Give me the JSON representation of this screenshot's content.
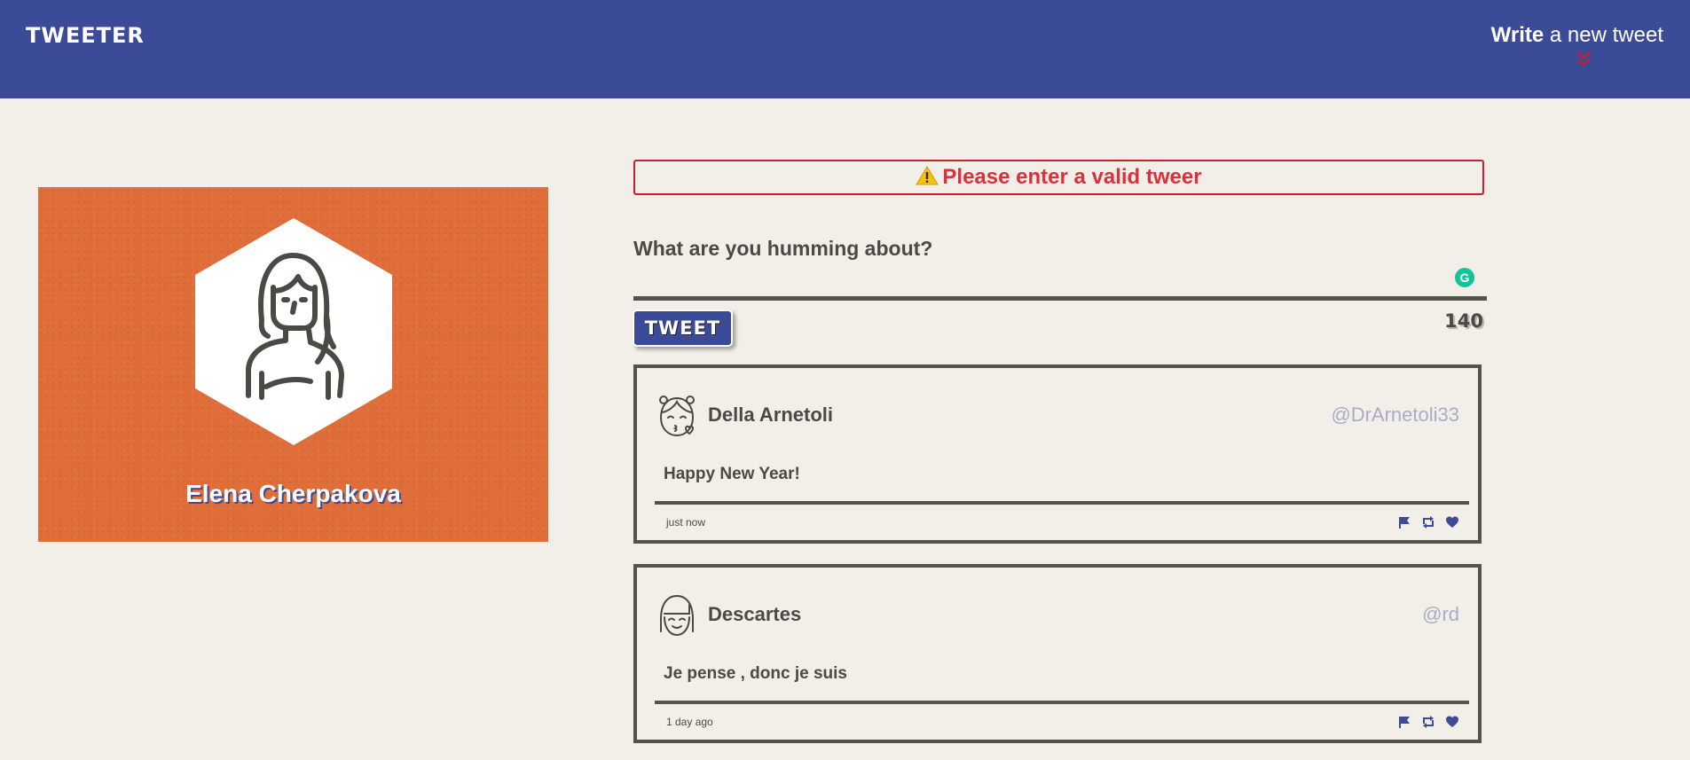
{
  "nav": {
    "brand": "TWEETER",
    "compose_bold": "Write",
    "compose_rest": " a new tweet",
    "chevron_icon": "double-chevron-down-icon"
  },
  "profile": {
    "name": "Elena Cherpakova",
    "avatar_icon": "woman-avatar-icon",
    "background_color": "#e06e3a"
  },
  "compose": {
    "error_text": "Please enter a valid tweer",
    "error_icon": "warning-icon",
    "label": "What are you humming about?",
    "input_value": "",
    "button_label": "TWEET",
    "counter": "140"
  },
  "tweets": [
    {
      "name": "Della Arnetoli",
      "handle": "@DrArnetoli33",
      "text": "Happy New Year!",
      "time": "just now",
      "avatar_icon": "kissing-face-avatar-icon"
    },
    {
      "name": "Descartes",
      "handle": "@rd",
      "text": "Je pense , donc je suis",
      "time": "1 day ago",
      "avatar_icon": "smiling-face-avatar-icon"
    }
  ],
  "colors": {
    "primary": "#3c4b98",
    "background": "#f2efe8",
    "error": "#d9313e",
    "border": "#555249"
  }
}
